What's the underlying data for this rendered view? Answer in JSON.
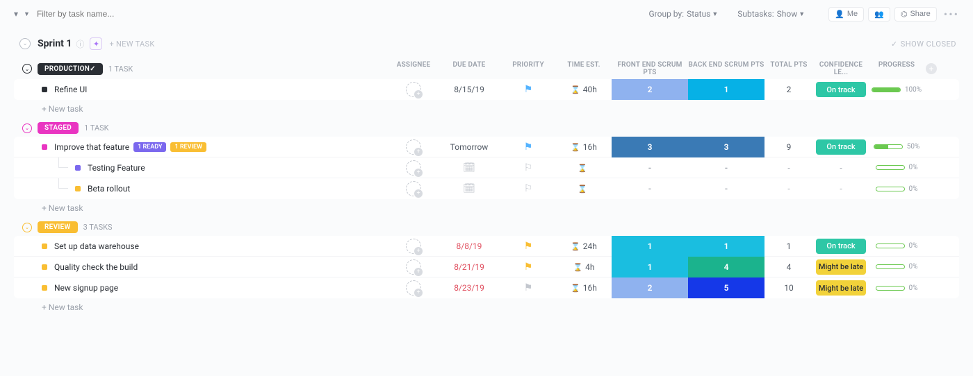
{
  "topbar": {
    "filter_placeholder": "Filter by task name...",
    "group_by_label": "Group by:",
    "group_by_value": "Status",
    "subtasks_label": "Subtasks:",
    "subtasks_value": "Show",
    "me_label": "Me",
    "share_label": "Share"
  },
  "sprint": {
    "title": "Sprint 1",
    "new_task_label": "+ NEW TASK",
    "show_closed_label": "SHOW CLOSED"
  },
  "columns": {
    "assignee": "ASSIGNEE",
    "due_date": "DUE DATE",
    "priority": "PRIORITY",
    "time_est": "TIME EST.",
    "front_pts": "FRONT END SCRUM PTS",
    "back_pts": "BACK END SCRUM PTS",
    "total_pts": "TOTAL PTS",
    "confidence": "CONFIDENCE LE...",
    "progress": "PROGRESS"
  },
  "groups": [
    {
      "name": "PRODUCTION",
      "count_label": "1 TASK",
      "pill_color": "#2a2e34",
      "circle_color": "#2a2e34",
      "has_check": true,
      "tasks": [
        {
          "sq": "#2a2e34",
          "name": "Refine UI",
          "tags": [],
          "sub": 0,
          "due": "8/15/19",
          "due_red": false,
          "due_icon": "date",
          "prio_icon": "flag",
          "prio_color": "#54b3ff",
          "time": "40h",
          "time_icon": "hour",
          "front": {
            "v": "2",
            "bg": "#8fb2ef"
          },
          "back": {
            "v": "1",
            "bg": "#06b1e6"
          },
          "total": "2",
          "conf": {
            "label": "On track",
            "bg": "#2ec7a6"
          },
          "prog": 100,
          "prog_label": "100%"
        }
      ],
      "new_task": "+ New task"
    },
    {
      "name": "STAGED",
      "count_label": "1 TASK",
      "pill_color": "#e935c1",
      "circle_color": "#e935c1",
      "has_check": false,
      "tasks": [
        {
          "sq": "#e935c1",
          "name": "Improve that feature",
          "tags": [
            {
              "label": "1 READY",
              "bg": "#7b68ee"
            },
            {
              "label": "1 REVIEW",
              "bg": "#f9be33"
            }
          ],
          "sub": 0,
          "due": "Tomorrow",
          "due_red": false,
          "due_icon": "date",
          "prio_icon": "flag",
          "prio_color": "#54b3ff",
          "time": "16h",
          "time_icon": "hour",
          "front": {
            "v": "3",
            "bg": "#3a7ab5"
          },
          "back": {
            "v": "3",
            "bg": "#3a7ab5"
          },
          "total": "9",
          "conf": {
            "label": "On track",
            "bg": "#2ec7a6"
          },
          "prog": 50,
          "prog_label": "50%"
        },
        {
          "sq": "#7b68ee",
          "name": "Testing Feature",
          "tags": [],
          "sub": 1,
          "due": "",
          "due_red": false,
          "due_icon": "cal",
          "prio_icon": "flag_outline",
          "prio_color": "",
          "time": "",
          "time_icon": "hour_only",
          "front": {
            "v": "-",
            "bg": ""
          },
          "back": {
            "v": "-",
            "bg": ""
          },
          "total": "-",
          "conf": {
            "label": "-",
            "bg": ""
          },
          "prog": 0,
          "prog_label": "0%"
        },
        {
          "sq": "#f9be33",
          "name": "Beta rollout",
          "tags": [],
          "sub": 1,
          "due": "",
          "due_red": false,
          "due_icon": "cal",
          "prio_icon": "flag_outline",
          "prio_color": "",
          "time": "",
          "time_icon": "hour_only",
          "front": {
            "v": "-",
            "bg": ""
          },
          "back": {
            "v": "-",
            "bg": ""
          },
          "total": "-",
          "conf": {
            "label": "-",
            "bg": ""
          },
          "prog": 0,
          "prog_label": "0%"
        }
      ],
      "new_task": "+ New task"
    },
    {
      "name": "REVIEW",
      "count_label": "3 TASKS",
      "pill_color": "#f9be33",
      "circle_color": "#f9be33",
      "has_check": false,
      "tasks": [
        {
          "sq": "#f9be33",
          "name": "Set up data warehouse",
          "tags": [],
          "sub": 0,
          "due": "8/8/19",
          "due_red": true,
          "due_icon": "date",
          "prio_icon": "flag",
          "prio_color": "#f9be33",
          "time": "24h",
          "time_icon": "hour",
          "front": {
            "v": "1",
            "bg": "#1abee0"
          },
          "back": {
            "v": "1",
            "bg": "#1abee0"
          },
          "total": "1",
          "conf": {
            "label": "On track",
            "bg": "#2ec7a6"
          },
          "prog": 0,
          "prog_label": "0%"
        },
        {
          "sq": "#f9be33",
          "name": "Quality check the build",
          "tags": [],
          "sub": 0,
          "due": "8/21/19",
          "due_red": true,
          "due_icon": "date",
          "prio_icon": "flag",
          "prio_color": "#f9be33",
          "time": "4h",
          "time_icon": "hour",
          "front": {
            "v": "1",
            "bg": "#1abee0"
          },
          "back": {
            "v": "4",
            "bg": "#1bb38d"
          },
          "total": "4",
          "conf": {
            "label": "Might be late",
            "bg": "#f2d23a",
            "fg": "#2a2e34"
          },
          "prog": 0,
          "prog_label": "0%"
        },
        {
          "sq": "#f9be33",
          "name": "New signup page",
          "tags": [],
          "sub": 0,
          "due": "8/23/19",
          "due_red": true,
          "due_icon": "date",
          "prio_icon": "flag",
          "prio_color": "#c3c7ce",
          "time": "16h",
          "time_icon": "hour",
          "front": {
            "v": "2",
            "bg": "#8fb2ef"
          },
          "back": {
            "v": "5",
            "bg": "#1538e8"
          },
          "total": "10",
          "conf": {
            "label": "Might be late",
            "bg": "#f2d23a",
            "fg": "#2a2e34"
          },
          "prog": 0,
          "prog_label": "0%"
        }
      ],
      "new_task": "+ New task"
    }
  ]
}
